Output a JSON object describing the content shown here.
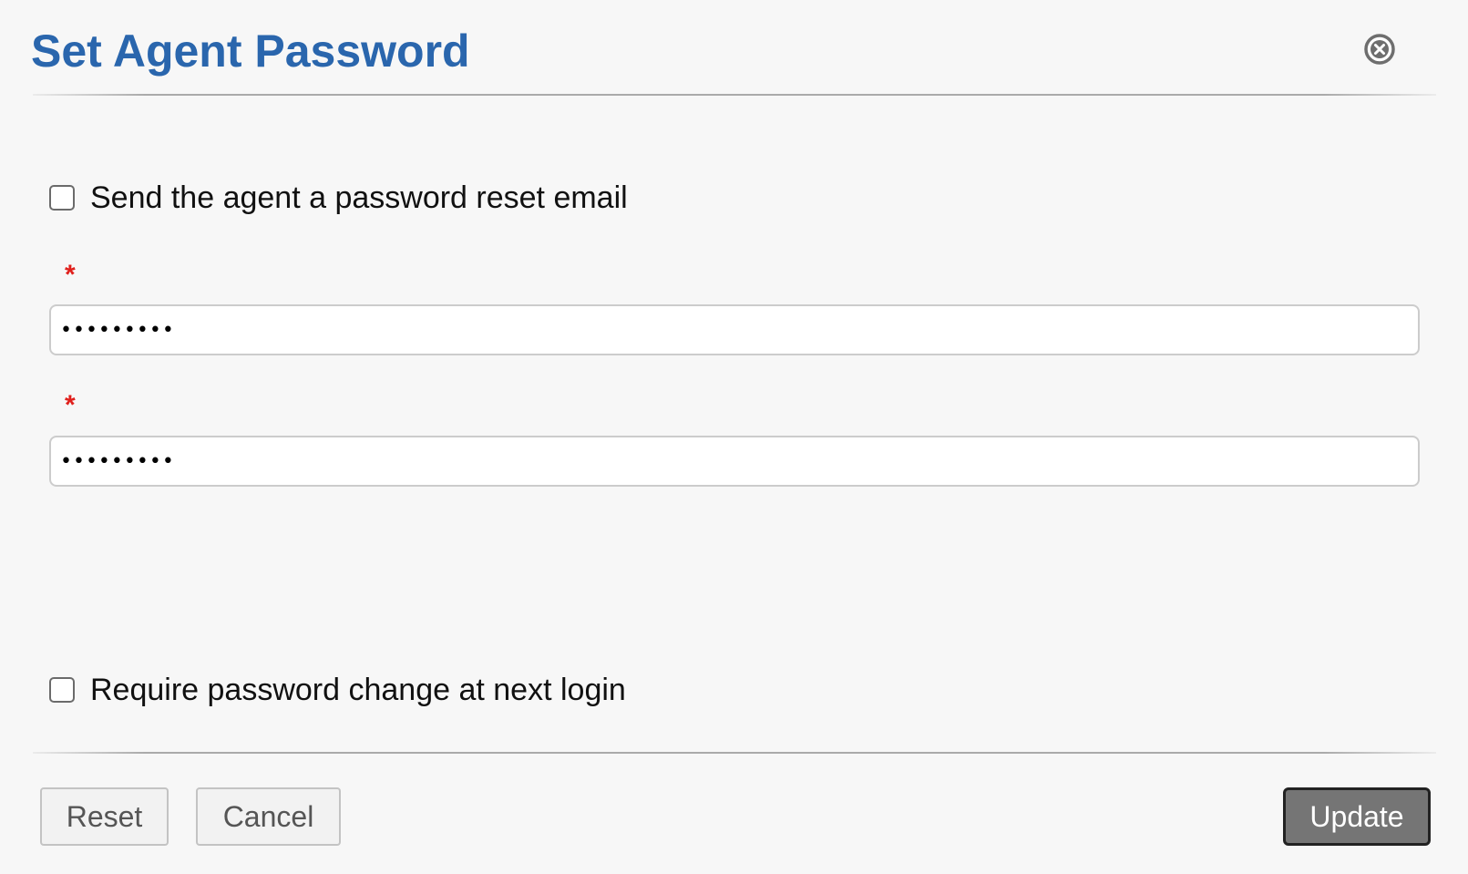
{
  "dialog": {
    "title": "Set Agent Password",
    "close_icon": "close-circle-icon"
  },
  "options": {
    "send_reset_email": {
      "label": "Send the agent a password reset email",
      "checked": false
    },
    "require_change": {
      "label": "Require password change at next login",
      "checked": false
    }
  },
  "fields": {
    "password": {
      "required_marker": "*",
      "value": "•••••••••"
    },
    "confirm_password": {
      "required_marker": "*",
      "value": "•••••••••"
    }
  },
  "buttons": {
    "reset_label": "Reset",
    "cancel_label": "Cancel",
    "update_label": "Update"
  },
  "colors": {
    "title": "#2a66ad",
    "required": "#e0201c",
    "primary_button": "#757575"
  }
}
